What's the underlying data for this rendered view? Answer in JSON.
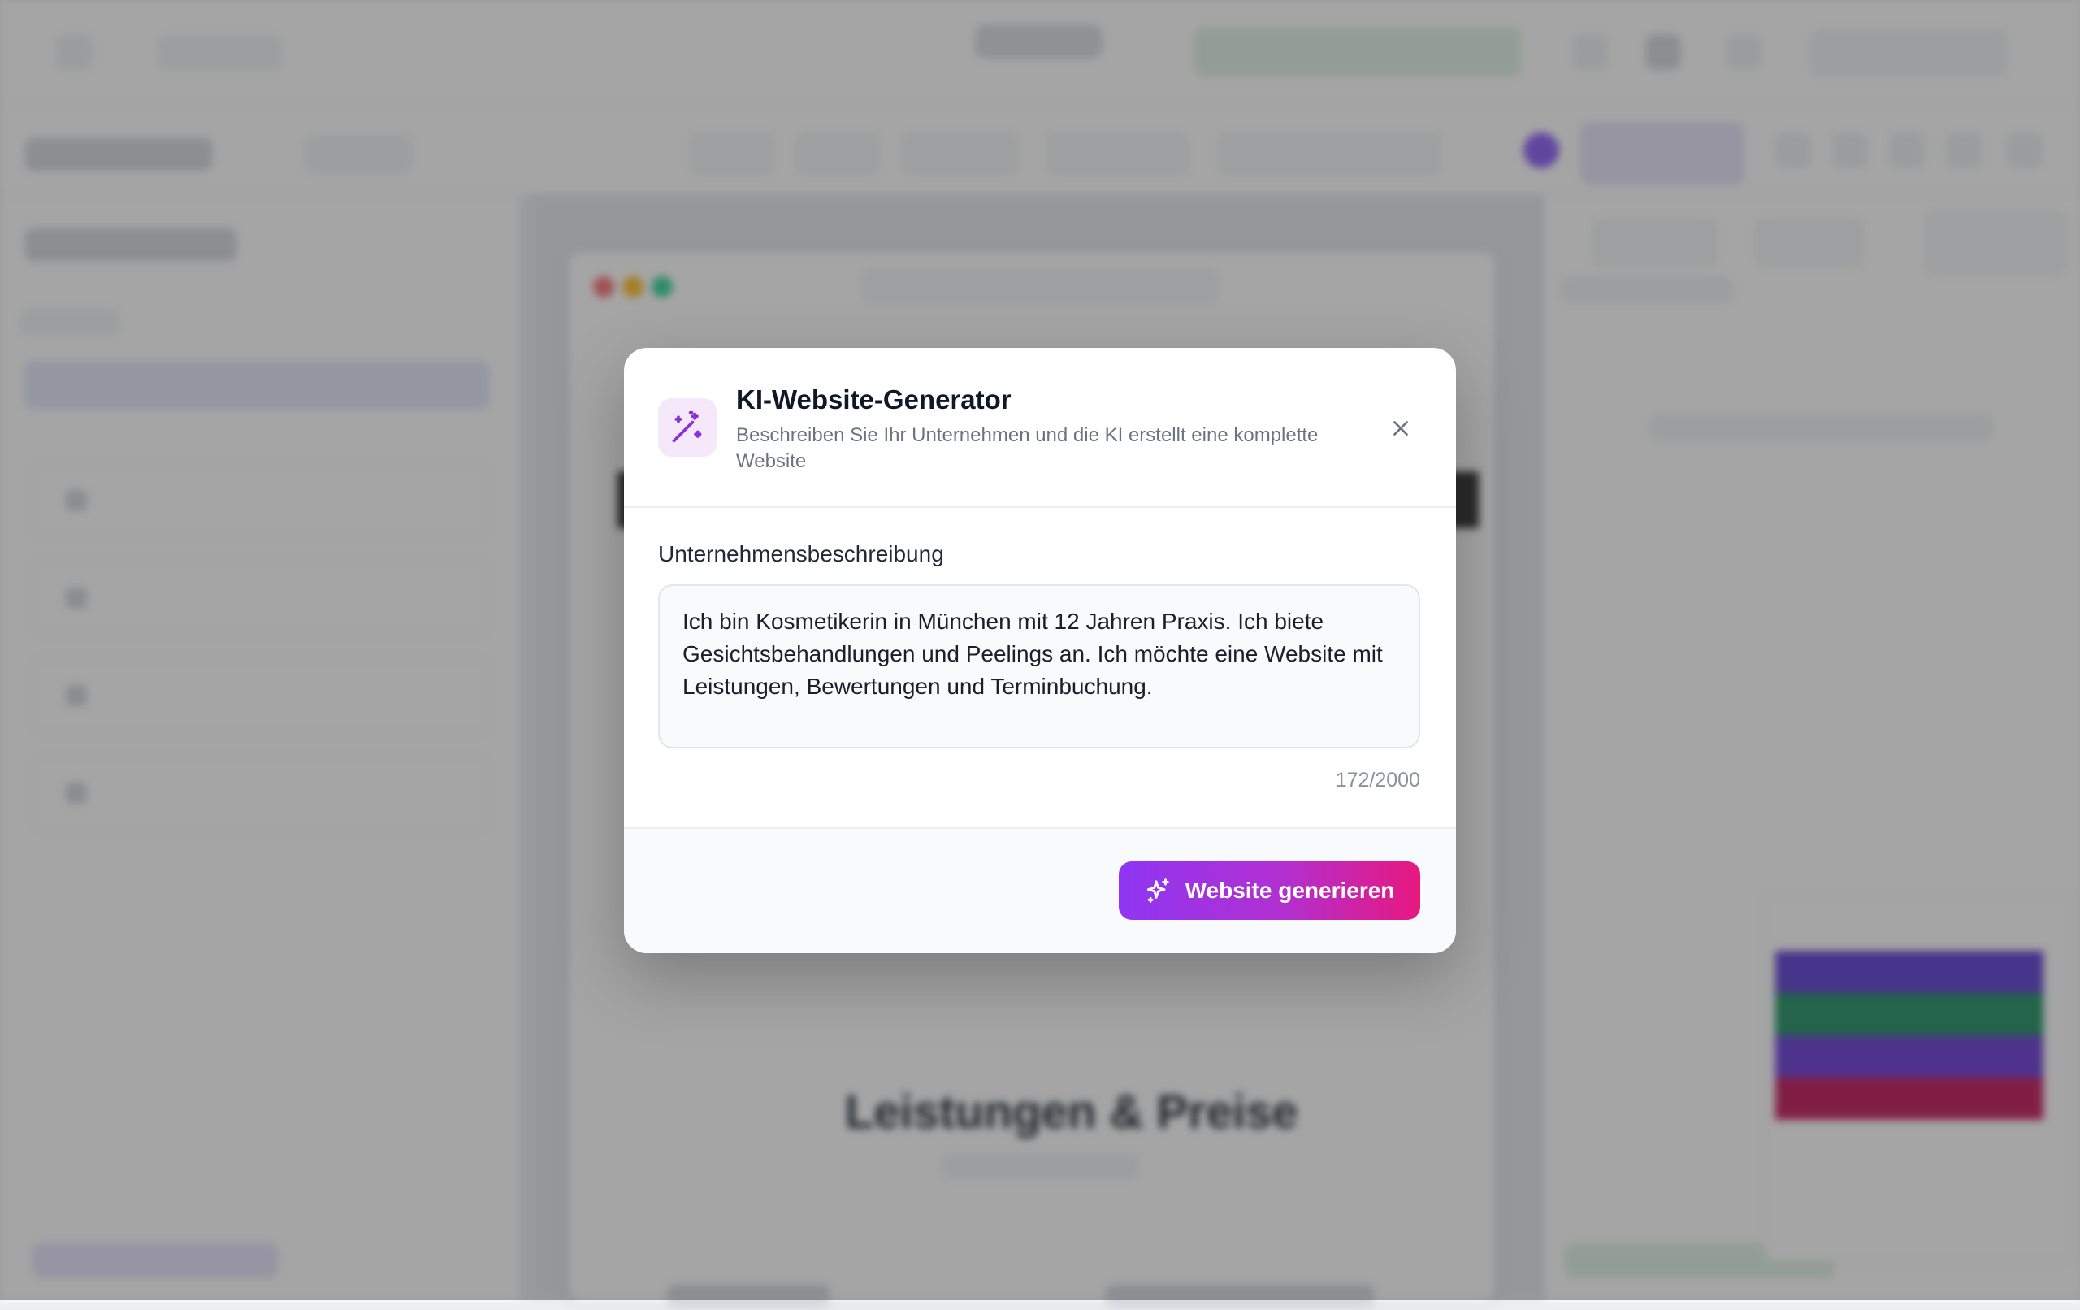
{
  "modal": {
    "title": "KI-Website-Generator",
    "subtitle": "Beschreiben Sie Ihr Unternehmen und die KI erstellt eine komplette Website",
    "field_label": "Unternehmensbeschreibung",
    "textarea_value": "Ich bin Kosmetikerin in München mit 12 Jahren Praxis. Ich biete Gesichtsbehandlungen und Peelings an. Ich möchte eine Website mit Leistungen, Bewertungen und Terminbuchung.",
    "char_count": "172/2000",
    "generate_label": "Website generieren",
    "icons": {
      "header": "magic-wand-icon",
      "close": "close-icon",
      "generate": "sparkles-icon"
    }
  },
  "background": {
    "canvas_heading": "Leistungen & Preise"
  },
  "colors": {
    "accent_gradient": [
      "#8f36f2",
      "#e8187e"
    ],
    "wand_bg": "#f6e8fb",
    "wand_icon": "#8b2fd6",
    "overlay": "rgba(40,40,40,0.42)",
    "palette_swatches": [
      "#5b3fd1",
      "#1f8f62",
      "#6a3bd6",
      "#c2185b"
    ]
  }
}
